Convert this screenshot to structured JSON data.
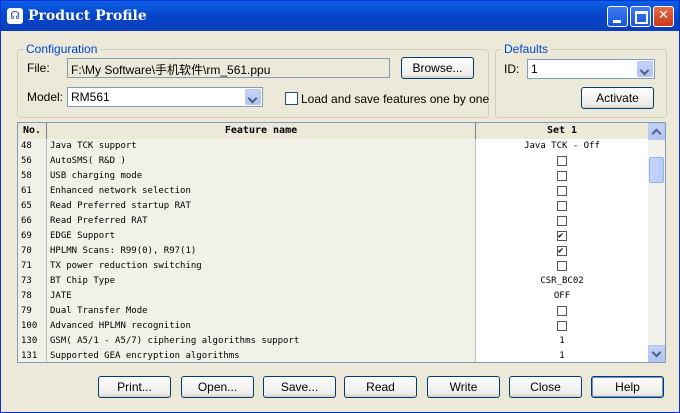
{
  "window": {
    "title": "Product Profile"
  },
  "configuration": {
    "legend": "Configuration",
    "file_label": "File:",
    "file_value": "F:\\My Software\\手机软件\\rm_561.ppu",
    "browse_label": "Browse...",
    "model_label": "Model:",
    "model_value": "RM561",
    "one_by_one_label": "Load and save features one by one",
    "one_by_one_checked": false
  },
  "defaults": {
    "legend": "Defaults",
    "id_label": "ID:",
    "id_value": "1",
    "activate_label": "Activate"
  },
  "table": {
    "headers": {
      "no": "No.",
      "feature": "Feature name",
      "set": "Set 1"
    },
    "rows": [
      {
        "no": "48",
        "feature": "Java TCK support",
        "type": "text",
        "value": "Java TCK - Off"
      },
      {
        "no": "56",
        "feature": "AutoSMS( R&D )",
        "type": "check",
        "checked": false
      },
      {
        "no": "58",
        "feature": "USB charging mode",
        "type": "check",
        "checked": false
      },
      {
        "no": "61",
        "feature": "Enhanced network selection",
        "type": "check",
        "checked": false
      },
      {
        "no": "65",
        "feature": "Read Preferred startup RAT",
        "type": "check",
        "checked": false
      },
      {
        "no": "66",
        "feature": "Read Preferred RAT",
        "type": "check",
        "checked": false
      },
      {
        "no": "69",
        "feature": "EDGE Support",
        "type": "check",
        "checked": true
      },
      {
        "no": "70",
        "feature": "HPLMN Scans: R99(0), R97(1)",
        "type": "check",
        "checked": true
      },
      {
        "no": "71",
        "feature": "TX power reduction switching",
        "type": "check",
        "checked": false
      },
      {
        "no": "73",
        "feature": "BT Chip Type",
        "type": "text",
        "value": "CSR_BC02"
      },
      {
        "no": "78",
        "feature": "JATE",
        "type": "text",
        "value": "OFF"
      },
      {
        "no": "79",
        "feature": "Dual Transfer Mode",
        "type": "check",
        "checked": false
      },
      {
        "no": "100",
        "feature": "Advanced HPLMN recognition",
        "type": "check",
        "checked": false
      },
      {
        "no": "130",
        "feature": "GSM( A5/1 - A5/7) ciphering algorithms support",
        "type": "text",
        "value": "1"
      },
      {
        "no": "131",
        "feature": "Supported GEA encryption algorithms",
        "type": "text",
        "value": "1"
      }
    ]
  },
  "buttons": {
    "print": "Print...",
    "open": "Open...",
    "save": "Save...",
    "read": "Read",
    "write": "Write",
    "close": "Close",
    "help": "Help"
  }
}
